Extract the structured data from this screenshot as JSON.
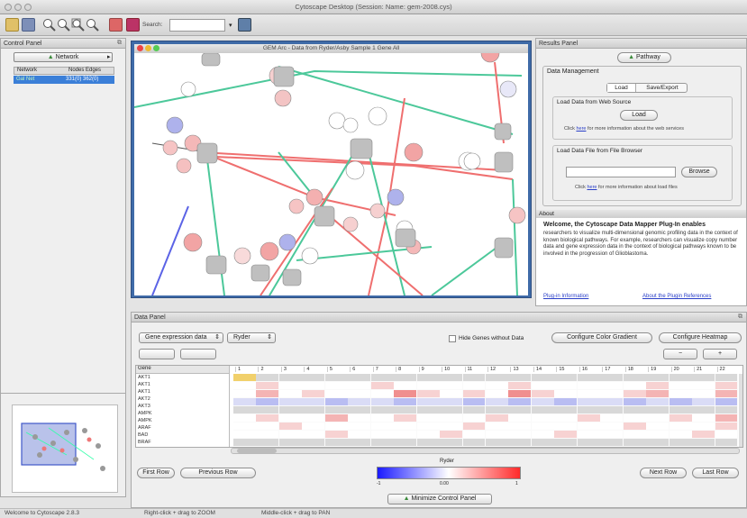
{
  "window": {
    "title": "Cytoscape Desktop (Session: Name: gem-2008.cys)"
  },
  "toolbar": {
    "search_label": "Search:",
    "search_value": ""
  },
  "control_panel": {
    "title": "Control Panel",
    "tab": "Network",
    "col_network": "Network",
    "col_nodes_edges": "Nodes Edges",
    "row_name": "Gal Net",
    "row_counts": "331(0) 362(0)"
  },
  "network_window": {
    "title": "GEM Arc - Data from Ryder/Asby Sample 1 Gene All"
  },
  "results_panel": {
    "title": "Results Panel",
    "tab": "Pathway",
    "section": "Data Management",
    "tab_load": "Load",
    "tab_save": "Save/Export",
    "load_header": "Load Data from Web Source",
    "load_button": "Load",
    "load_note_pre": "Click ",
    "load_note_link": "here",
    "load_note_post": " for more information about the web services",
    "file_header": "Load Data File from File Browser",
    "browse_button": "Browse",
    "file_note_pre": "Click ",
    "file_note_link": "here",
    "file_note_post": " for more information about load files"
  },
  "about": {
    "title": "About",
    "heading": "Welcome, the Cytoscape Data Mapper Plug-In enables",
    "body": "researchers to visualize multi-dimensional genomic profiling data in the context of known biological pathways. For example, researchers can visualize copy number data and gene expression data in the context of biological pathways known to be involved in the progression of Glioblastoma.",
    "link1": "Plug-in Information",
    "link2": "About the Plugin References"
  },
  "data_panel": {
    "title": "Data Panel",
    "dataset_select": "Gene expression data",
    "mode_select": "Ryder",
    "hide_checkbox": "Hide Genes without Data",
    "configure_color": "Configure Color Gradient",
    "configure_heatmap": "Configure Heatmap",
    "col_header": "Gene",
    "genes": [
      "AKT1",
      "AKT1",
      "AKT1",
      "AKT2",
      "AKT3",
      "AMPK",
      "AMPK",
      "ARAF",
      "BAD",
      "BRAF"
    ],
    "sample_cols": [
      "1",
      "2",
      "3",
      "4",
      "5",
      "6",
      "7",
      "8",
      "9",
      "10",
      "11",
      "12",
      "13",
      "14",
      "15",
      "16",
      "17",
      "18",
      "19",
      "20",
      "21",
      "22"
    ],
    "first_row": "First Row",
    "prev_row": "Previous Row",
    "next_row": "Next Row",
    "last_row": "Last Row",
    "legend_title": "Ryder",
    "legend_mid": "0.00",
    "legend_min": "-1",
    "legend_max": "1",
    "minimize_button": "Minimize Control Panel"
  },
  "statusbar": {
    "welcome": "Welcome to Cytoscape 2.8.3",
    "hint1": "Right-click + drag to ZOOM",
    "hint2": "Middle-click + drag to PAN"
  },
  "colors": {
    "accent": "#3d6fb3",
    "node_gray": "#b7b7b7",
    "edge_green": "#4cc89a",
    "edge_red": "#ef6f6f",
    "edge_blue": "#5b63e6"
  }
}
